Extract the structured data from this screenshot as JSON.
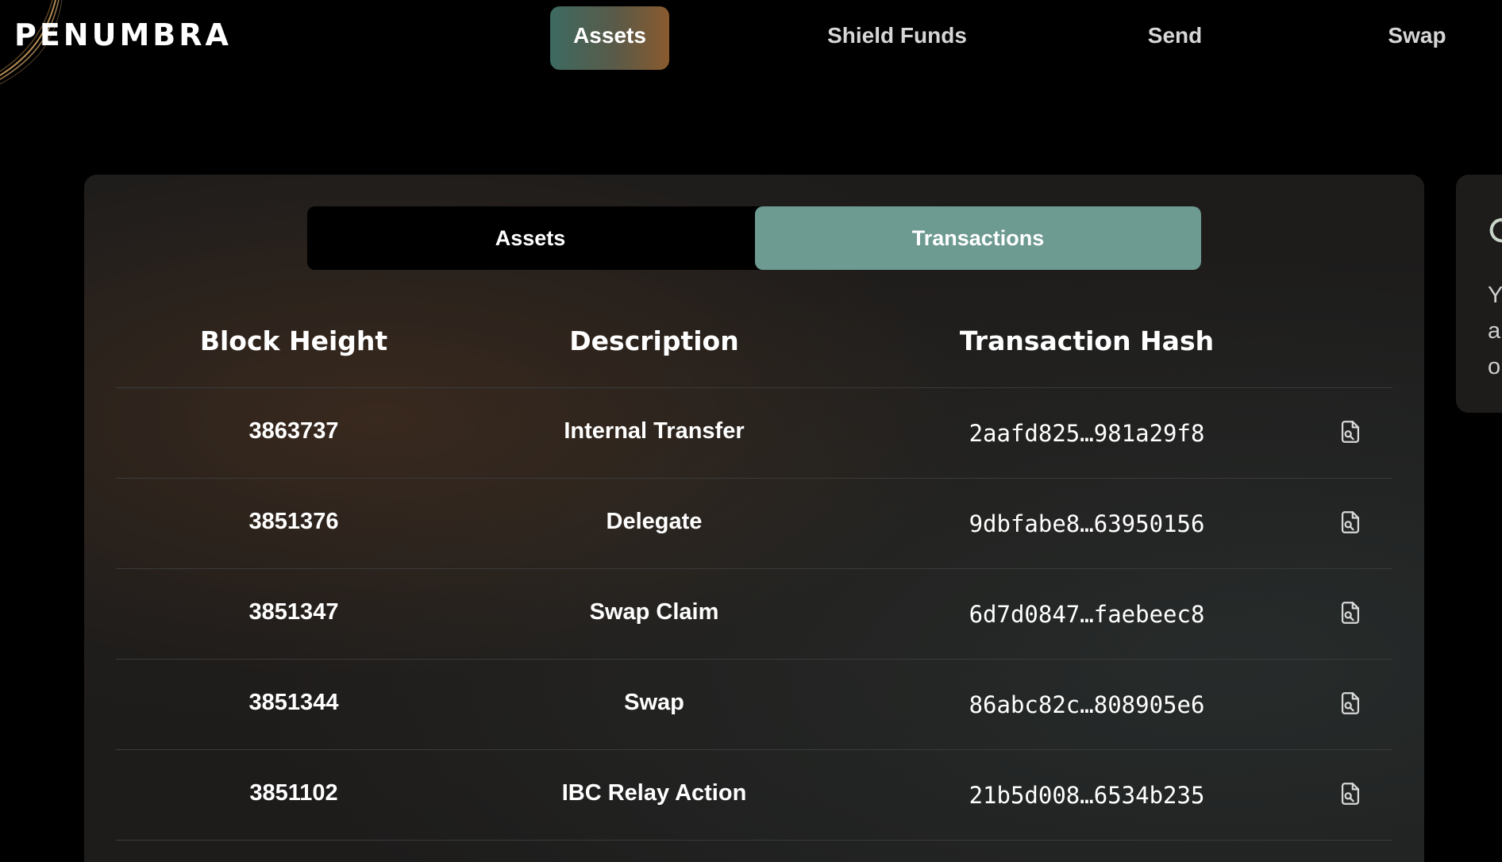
{
  "app": {
    "logo_text": "PENUMBRA"
  },
  "nav": {
    "items": [
      {
        "label": "Assets",
        "active": true
      },
      {
        "label": "Shield Funds",
        "active": false
      },
      {
        "label": "Send",
        "active": false
      },
      {
        "label": "Swap",
        "active": false
      }
    ]
  },
  "toggle": {
    "options": [
      {
        "label": "Assets",
        "selected": false
      },
      {
        "label": "Transactions",
        "selected": true
      }
    ]
  },
  "table": {
    "columns": [
      "Block Height",
      "Description",
      "Transaction Hash"
    ],
    "rows": [
      {
        "block_height": "3863737",
        "description": "Internal Transfer",
        "hash": "2aafd825…981a29f8"
      },
      {
        "block_height": "3851376",
        "description": "Delegate",
        "hash": "9dbfabe8…63950156"
      },
      {
        "block_height": "3851347",
        "description": "Swap Claim",
        "hash": "6d7d0847…faebeec8"
      },
      {
        "block_height": "3851344",
        "description": "Swap",
        "hash": "86abc82c…808905e6"
      },
      {
        "block_height": "3851102",
        "description": "IBC Relay Action",
        "hash": "21b5d008…6534b235"
      }
    ],
    "row_action_icon": "document-search-icon"
  },
  "side_panel": {
    "text_lines": [
      "Y",
      "a",
      "o"
    ]
  },
  "colors": {
    "background": "#000000",
    "card": "#1d1c1b",
    "toggle_selected": "#6d9a91",
    "nav_active_gradient_start": "#3d6a61",
    "nav_active_gradient_end": "#8a5a2e"
  }
}
